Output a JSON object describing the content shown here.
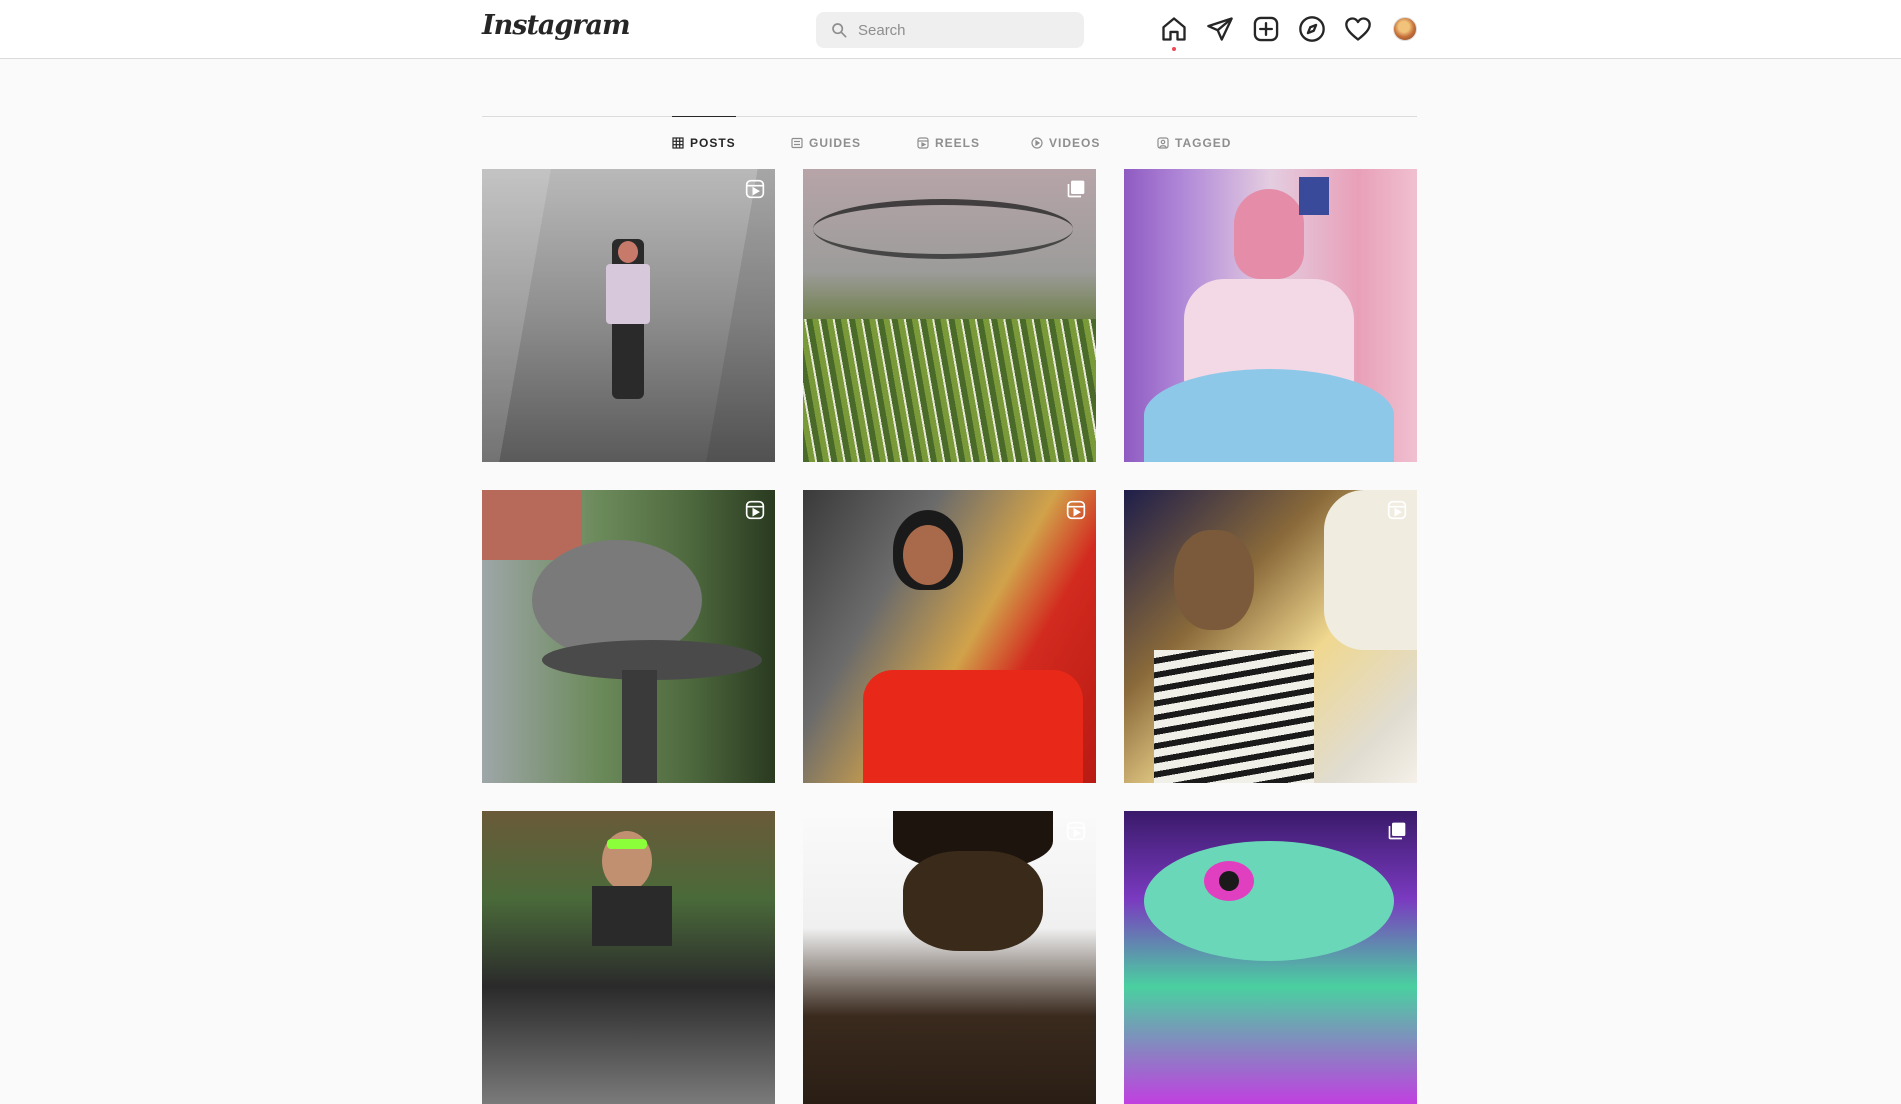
{
  "app": {
    "logo_text": "Instagram"
  },
  "search": {
    "placeholder": "Search"
  },
  "nav": {
    "items": [
      "home",
      "direct",
      "new-post",
      "explore",
      "activity",
      "profile"
    ]
  },
  "tabs": [
    {
      "label": "POSTS",
      "icon": "grid-icon",
      "active": true
    },
    {
      "label": "GUIDES",
      "icon": "guides-icon",
      "active": false
    },
    {
      "label": "REELS",
      "icon": "reels-icon",
      "active": false
    },
    {
      "label": "VIDEOS",
      "icon": "video-icon",
      "active": false
    },
    {
      "label": "TAGGED",
      "icon": "tagged-icon",
      "active": false
    }
  ],
  "posts": [
    {
      "badge": "reel-icon"
    },
    {
      "badge": "carousel-icon"
    },
    {
      "badge": ""
    },
    {
      "badge": "reel-icon"
    },
    {
      "badge": "reel-icon"
    },
    {
      "badge": "reel-icon"
    },
    {
      "badge": ""
    },
    {
      "badge": "reel-icon"
    },
    {
      "badge": "carousel-icon"
    }
  ],
  "colors": {
    "background": "#fafafa",
    "border": "#dbdbdb",
    "text_primary": "#262626",
    "text_secondary": "#8e8e8e",
    "notification": "#ed4956"
  }
}
